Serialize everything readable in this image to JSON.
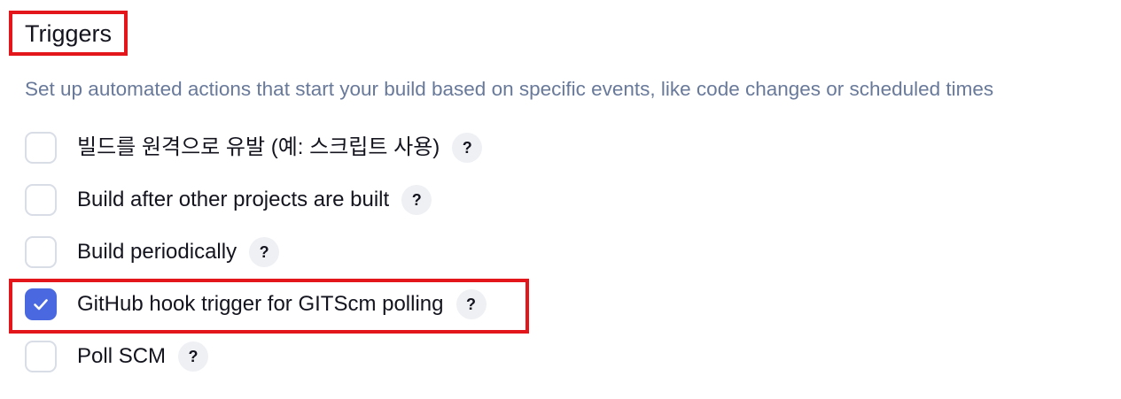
{
  "section": {
    "title": "Triggers",
    "description": "Set up automated actions that start your build based on specific events, like code changes or scheduled times"
  },
  "options": [
    {
      "label": "빌드를 원격으로 유발 (예: 스크립트 사용)",
      "checked": false,
      "help": "?"
    },
    {
      "label": "Build after other projects are built",
      "checked": false,
      "help": "?"
    },
    {
      "label": "Build periodically",
      "checked": false,
      "help": "?"
    },
    {
      "label": "GitHub hook trigger for GITScm polling",
      "checked": true,
      "help": "?"
    },
    {
      "label": "Poll SCM",
      "checked": false,
      "help": "?"
    }
  ],
  "icons": {
    "check": "check-icon",
    "help": "question-mark-icon"
  },
  "colors": {
    "accent": "#4a69e0",
    "highlight": "#e3161b",
    "description_text": "#68799a"
  }
}
